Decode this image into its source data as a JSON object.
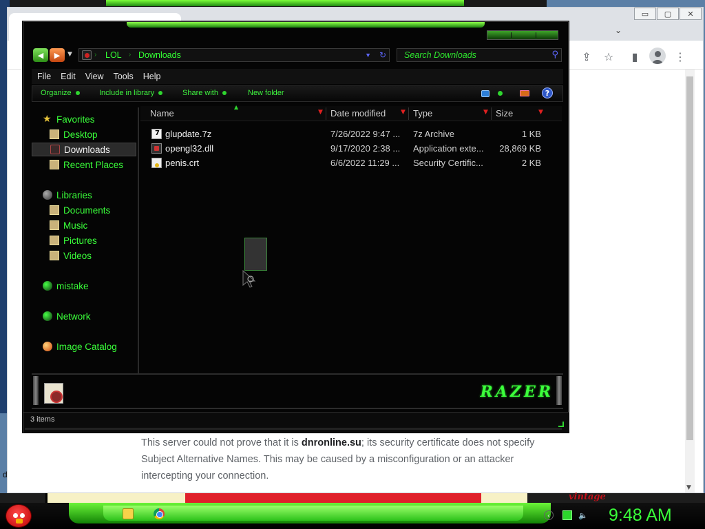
{
  "browser": {
    "window_buttons": [
      "▭",
      "▢",
      "✕"
    ],
    "tab_dropdown_icon": "chevron-down",
    "toolbar_icons": [
      "share-icon",
      "star-icon",
      "side-panel-icon",
      "profile-icon",
      "menu-icon"
    ],
    "warning": {
      "part1": "This server could not prove that it is ",
      "domain": "dnronline.su",
      "part2": "; its security certificate does not specify Subject Alternative Names. This may be caused by a misconfiguration or an attacker intercepting your connection."
    },
    "stray_char": "d"
  },
  "background": {
    "vintage_text": "vintage"
  },
  "explorer": {
    "address": {
      "crumbs": [
        "LOL",
        "Downloads"
      ]
    },
    "search_placeholder": "Search Downloads",
    "menu": [
      "File",
      "Edit",
      "View",
      "Tools",
      "Help"
    ],
    "commands": [
      "Organize",
      "Include in library",
      "Share with",
      "New folder"
    ],
    "help_label": "?",
    "nav": {
      "favorites": "Favorites",
      "desktop": "Desktop",
      "downloads": "Downloads",
      "recent": "Recent Places",
      "libraries": "Libraries",
      "documents": "Documents",
      "music": "Music",
      "pictures": "Pictures",
      "videos": "Videos",
      "homegroup": "mistake",
      "network": "Network",
      "image_catalog": "Image Catalog"
    },
    "columns": [
      "Name",
      "Date modified",
      "Type",
      "Size"
    ],
    "files": [
      {
        "name": "glupdate.7z",
        "date": "7/26/2022 9:47 ...",
        "type": "7z Archive",
        "size": "1 KB"
      },
      {
        "name": "opengl32.dll",
        "date": "9/17/2020 2:38 ...",
        "type": "Application exte...",
        "size": "28,869 KB"
      },
      {
        "name": "penis.crt",
        "date": "6/6/2022 11:29 ...",
        "type": "Security Certific...",
        "size": "2 KB"
      }
    ],
    "logo_text": "RAZER",
    "status": "3 items"
  },
  "taskbar": {
    "clock": "9:48 AM"
  },
  "colors": {
    "accent_green": "#3aff3a",
    "window_bg": "#050505"
  }
}
